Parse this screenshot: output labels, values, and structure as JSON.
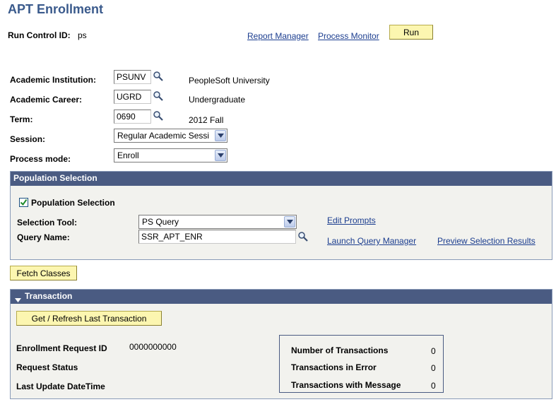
{
  "page": {
    "title": "APT Enrollment"
  },
  "run_control": {
    "label": "Run Control ID:",
    "value": "ps"
  },
  "header_links": {
    "report_manager": "Report Manager",
    "process_monitor": "Process Monitor"
  },
  "run_button": "Run",
  "fields": {
    "institution": {
      "label": "Academic Institution:",
      "value": "PSUNV",
      "description": "PeopleSoft University"
    },
    "career": {
      "label": "Academic Career:",
      "value": "UGRD",
      "description": "Undergraduate"
    },
    "term": {
      "label": "Term:",
      "value": "0690",
      "description": "2012 Fall"
    },
    "session": {
      "label": "Session:",
      "value": "Regular Academic Sessi"
    },
    "process_mode": {
      "label": "Process mode:",
      "value": "Enroll"
    }
  },
  "population": {
    "header": "Population Selection",
    "checkbox_label": "Population Selection",
    "checked": true,
    "selection_tool_label": "Selection Tool:",
    "selection_tool_value": "PS Query",
    "query_name_label": "Query Name:",
    "query_name_value": "SSR_APT_ENR",
    "edit_prompts": "Edit Prompts",
    "launch_query_manager": "Launch Query Manager",
    "preview_selection_results": "Preview Selection Results"
  },
  "fetch_button": "Fetch Classes",
  "transaction": {
    "header": "Transaction",
    "refresh_button": "Get / Refresh Last Transaction",
    "enrollment_request_id_label": "Enrollment Request ID",
    "enrollment_request_id_value": "0000000000",
    "request_status_label": "Request Status",
    "last_update_label": "Last Update DateTime",
    "stats": {
      "num_transactions_label": "Number of Transactions",
      "num_transactions_value": "0",
      "in_error_label": "Transactions in Error",
      "in_error_value": "0",
      "with_message_label": "Transactions with Message",
      "with_message_value": "0"
    }
  },
  "colors": {
    "title": "#3a5a8c",
    "panel_header": "#4a5b82",
    "button_bg": "#fcf6b0",
    "link": "#1b3d8f",
    "panel_bg": "#f2f2ee"
  }
}
